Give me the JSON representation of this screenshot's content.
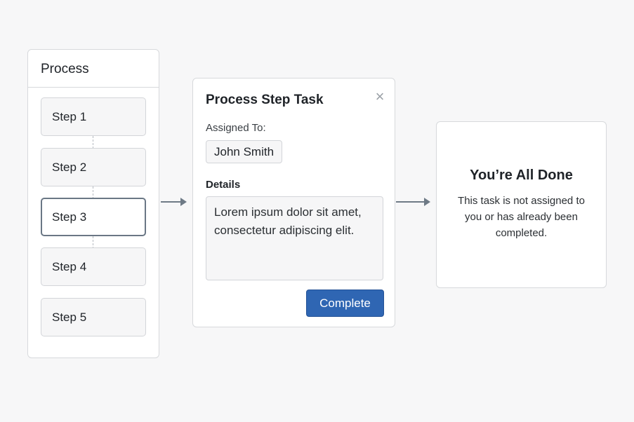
{
  "process": {
    "title": "Process",
    "steps": [
      {
        "label": "Step 1"
      },
      {
        "label": "Step 2"
      },
      {
        "label": "Step 3"
      },
      {
        "label": "Step 4"
      },
      {
        "label": "Step 5"
      }
    ],
    "active_step": "Step 3"
  },
  "task_dialog": {
    "title": "Process Step Task",
    "close_icon": "close-icon",
    "assigned_label": "Assigned To:",
    "assignee": "John Smith",
    "details_label": "Details",
    "details_text": "Lorem ipsum dolor sit amet, consectetur adipiscing elit.",
    "complete_label": "Complete"
  },
  "done_panel": {
    "title": "You’re All Done",
    "message": "This task is not assigned to you or has already been completed."
  },
  "colors": {
    "accent": "#2f66b3",
    "background": "#f7f7f8",
    "border": "#d7d9dc",
    "arrow": "#6e7a86"
  }
}
